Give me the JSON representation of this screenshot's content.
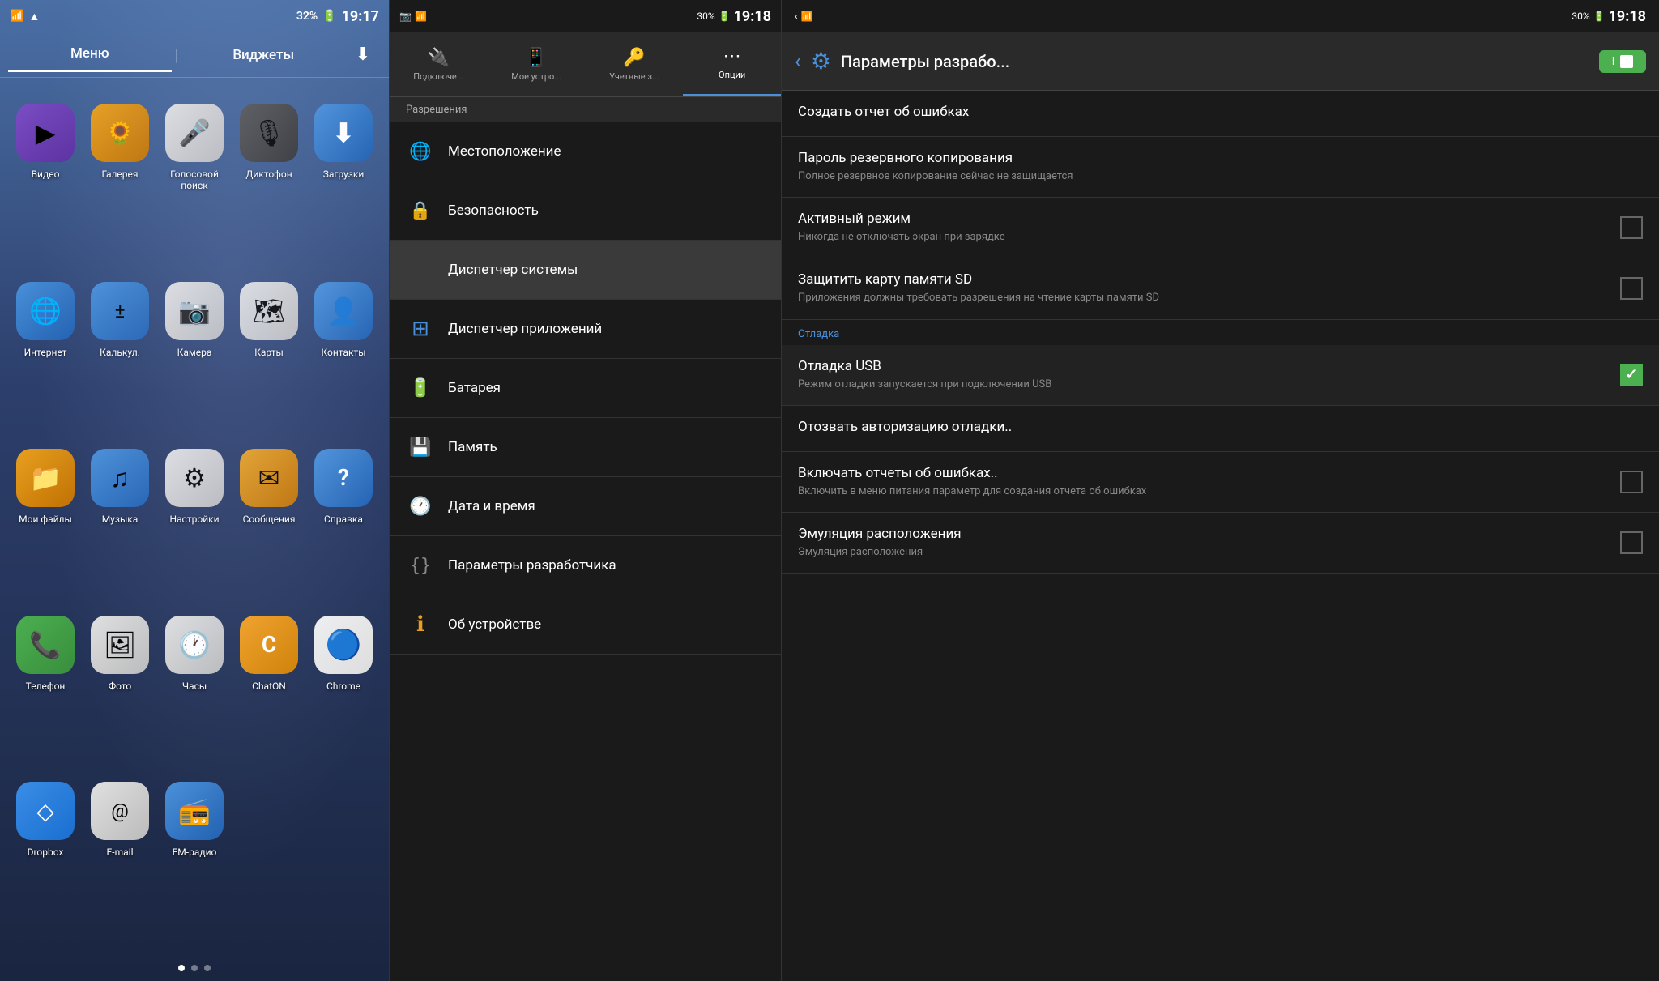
{
  "panel1": {
    "status": {
      "wifi": "📶",
      "signal": "▲",
      "battery": "32%",
      "time": "19:17"
    },
    "tabs": [
      "Меню",
      "Виджеты"
    ],
    "active_tab": "Меню",
    "apps": [
      {
        "id": "video",
        "label": "Видео",
        "icon": "▶",
        "icon_class": "icon-video"
      },
      {
        "id": "gallery",
        "label": "Галерея",
        "icon": "🌻",
        "icon_class": "icon-gallery"
      },
      {
        "id": "voice",
        "label": "Голосовой поиск",
        "icon": "🎤",
        "icon_class": "icon-voice"
      },
      {
        "id": "recorder",
        "label": "Диктофон",
        "icon": "🎙",
        "icon_class": "icon-recorder"
      },
      {
        "id": "downloads",
        "label": "Загрузки",
        "icon": "⬇",
        "icon_class": "icon-downloads"
      },
      {
        "id": "internet",
        "label": "Интернет",
        "icon": "🌐",
        "icon_class": "icon-internet"
      },
      {
        "id": "calc",
        "label": "Калькул.",
        "icon": "±",
        "icon_class": "icon-calc"
      },
      {
        "id": "camera",
        "label": "Камера",
        "icon": "📷",
        "icon_class": "icon-camera"
      },
      {
        "id": "maps",
        "label": "Карты",
        "icon": "🗺",
        "icon_class": "icon-maps"
      },
      {
        "id": "contacts",
        "label": "Контакты",
        "icon": "👤",
        "icon_class": "icon-contacts"
      },
      {
        "id": "myfiles",
        "label": "Мои файлы",
        "icon": "📁",
        "icon_class": "icon-myfiles"
      },
      {
        "id": "music",
        "label": "Музыка",
        "icon": "♫",
        "icon_class": "icon-music"
      },
      {
        "id": "settings",
        "label": "Настройки",
        "icon": "⚙",
        "icon_class": "icon-settings"
      },
      {
        "id": "messages",
        "label": "Сообщения",
        "icon": "✉",
        "icon_class": "icon-messages"
      },
      {
        "id": "help",
        "label": "Справка",
        "icon": "?",
        "icon_class": "icon-help"
      },
      {
        "id": "phone",
        "label": "Телефон",
        "icon": "📞",
        "icon_class": "icon-phone"
      },
      {
        "id": "photos",
        "label": "Фото",
        "icon": "🖼",
        "icon_class": "icon-photos"
      },
      {
        "id": "clock",
        "label": "Часы",
        "icon": "🕐",
        "icon_class": "icon-clock"
      },
      {
        "id": "chaton",
        "label": "ChatON",
        "icon": "C",
        "icon_class": "icon-chaton"
      },
      {
        "id": "chrome",
        "label": "Chrome",
        "icon": "◎",
        "icon_class": "icon-chrome"
      },
      {
        "id": "dropbox",
        "label": "Dropbox",
        "icon": "◇",
        "icon_class": "icon-dropbox"
      },
      {
        "id": "email",
        "label": "E-mail",
        "icon": "@",
        "icon_class": "icon-email"
      },
      {
        "id": "fmradio",
        "label": "FM-радио",
        "icon": "📻",
        "icon_class": "icon-fmradio"
      }
    ],
    "dots": [
      true,
      false,
      false
    ]
  },
  "panel2": {
    "status": {
      "battery": "30%",
      "time": "19:18"
    },
    "tabs": [
      {
        "label": "Подключе...",
        "icon": "🔌"
      },
      {
        "label": "Мое устро...",
        "icon": "📱"
      },
      {
        "label": "Учетные з...",
        "icon": "🔑"
      },
      {
        "label": "Опции",
        "icon": "⋯",
        "active": true
      }
    ],
    "section": "Разрешения",
    "items": [
      {
        "label": "Местоположение",
        "icon": "🌐",
        "icon_color": "#4caf50"
      },
      {
        "label": "Безопасность",
        "icon": "🔒",
        "icon_color": "#4a90d9"
      },
      {
        "label": "Диспетчер системы",
        "icon": "",
        "active": true
      },
      {
        "label": "Диспетчер приложений",
        "icon": "⊞",
        "icon_color": "#4a90d9"
      },
      {
        "label": "Батарея",
        "icon": "🔋",
        "icon_color": "#4caf50"
      },
      {
        "label": "Память",
        "icon": "💾",
        "icon_color": "#666"
      },
      {
        "label": "Дата и время",
        "icon": "🕐",
        "icon_color": "#666"
      },
      {
        "label": "Параметры разработчика",
        "icon": "{}",
        "icon_color": "#666"
      },
      {
        "label": "Об устройстве",
        "icon": "ℹ",
        "icon_color": "#e8a020"
      }
    ]
  },
  "panel3": {
    "status": {
      "battery": "30%",
      "time": "19:18"
    },
    "header": {
      "title": "Параметры разрабо...",
      "toggle_label": "I"
    },
    "items": [
      {
        "type": "item",
        "title": "Создать отчет об ошибках",
        "subtitle": "",
        "checkbox": false,
        "has_checkbox": false
      },
      {
        "type": "item",
        "title": "Пароль резервного копирования",
        "subtitle": "Полное резервное копирование сейчас не защищается",
        "checkbox": false,
        "has_checkbox": false
      },
      {
        "type": "item",
        "title": "Активный режим",
        "subtitle": "Никогда не отключать экран при зарядке",
        "checkbox": false,
        "has_checkbox": true
      },
      {
        "type": "item",
        "title": "Защитить карту памяти SD",
        "subtitle": "Приложения должны требовать разрешения на чтение карты памяти SD",
        "checkbox": false,
        "has_checkbox": true
      },
      {
        "type": "section",
        "title": "Отладка"
      },
      {
        "type": "item",
        "title": "Отладка USB",
        "subtitle": "Режим отладки запускается при подключении USB",
        "checkbox": true,
        "has_checkbox": true
      },
      {
        "type": "item",
        "title": "Отозвать авторизацию отладки..",
        "subtitle": "",
        "checkbox": false,
        "has_checkbox": false
      },
      {
        "type": "item",
        "title": "Включать отчеты об ошибках..",
        "subtitle": "Включить в меню питания параметр для создания отчета об ошибках",
        "checkbox": false,
        "has_checkbox": true
      },
      {
        "type": "item",
        "title": "Эмуляция расположения",
        "subtitle": "Эмуляция расположения",
        "checkbox": false,
        "has_checkbox": true
      }
    ]
  }
}
